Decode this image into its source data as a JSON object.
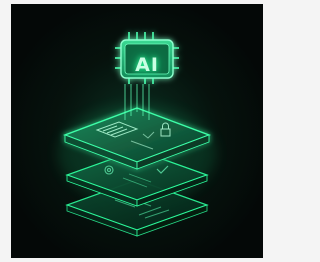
{
  "chip": {
    "label": "AI"
  },
  "palette": {
    "background": "#040807",
    "glow": "#2dff9e",
    "layer_fill": "#0e4a32",
    "frame": "#f4f4f4"
  },
  "icons": [
    "chip-icon",
    "document-icon",
    "gear-icon",
    "check-icon",
    "lock-icon",
    "list-icon"
  ]
}
